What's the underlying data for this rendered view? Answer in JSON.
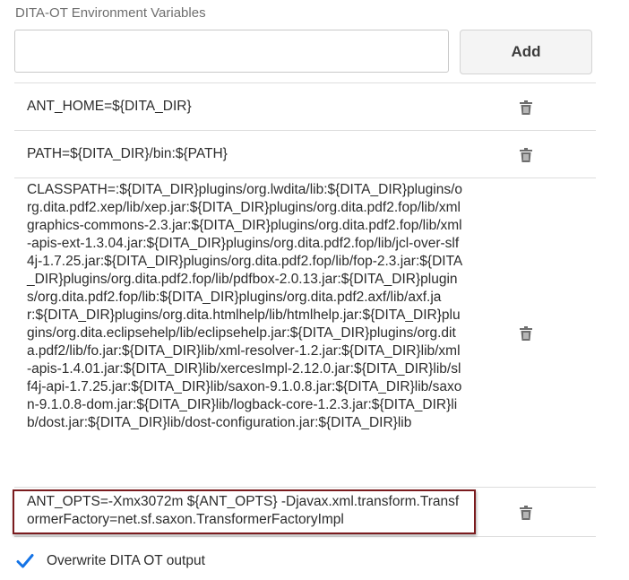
{
  "section": {
    "title": "DITA-OT Environment Variables"
  },
  "input": {
    "value": "",
    "placeholder": ""
  },
  "add_button": {
    "label": "Add"
  },
  "variables": [
    {
      "text": "ANT_HOME=${DITA_DIR}"
    },
    {
      "text": "PATH=${DITA_DIR}/bin:${PATH}"
    },
    {
      "text": "CLASSPATH=:${DITA_DIR}plugins/org.lwdita/lib:${DITA_DIR}plugins/org.dita.pdf2.xep/lib/xep.jar:${DITA_DIR}plugins/org.dita.pdf2.fop/lib/xmlgraphics-commons-2.3.jar:${DITA_DIR}plugins/org.dita.pdf2.fop/lib/xml-apis-ext-1.3.04.jar:${DITA_DIR}plugins/org.dita.pdf2.fop/lib/jcl-over-slf4j-1.7.25.jar:${DITA_DIR}plugins/org.dita.pdf2.fop/lib/fop-2.3.jar:${DITA_DIR}plugins/org.dita.pdf2.fop/lib/pdfbox-2.0.13.jar:${DITA_DIR}plugins/org.dita.pdf2.fop/lib:${DITA_DIR}plugins/org.dita.pdf2.axf/lib/axf.jar:${DITA_DIR}plugins/org.dita.htmlhelp/lib/htmlhelp.jar:${DITA_DIR}plugins/org.dita.eclipsehelp/lib/eclipsehelp.jar:${DITA_DIR}plugins/org.dita.pdf2/lib/fo.jar:${DITA_DIR}lib/xml-resolver-1.2.jar:${DITA_DIR}lib/xml-apis-1.4.01.jar:${DITA_DIR}lib/xercesImpl-2.12.0.jar:${DITA_DIR}lib/slf4j-api-1.7.25.jar:${DITA_DIR}lib/saxon-9.1.0.8.jar:${DITA_DIR}lib/saxon-9.1.0.8-dom.jar:${DITA_DIR}lib/logback-core-1.2.3.jar:${DITA_DIR}lib/dost.jar:${DITA_DIR}lib/dost-configuration.jar:${DITA_DIR}lib"
    },
    {
      "text": "ANT_OPTS=-Xmx3072m ${ANT_OPTS} -Djavax.xml.transform.TransformerFactory=net.sf.saxon.TransformerFactoryImpl"
    }
  ],
  "icons": {
    "delete": "trash-icon",
    "check": "checkmark-icon"
  },
  "colors": {
    "accent": "#1473e6",
    "highlight": "#7a1b1e",
    "icon": "#6e6e6e"
  },
  "overwrite": {
    "label": "Overwrite DITA OT output",
    "checked": true
  }
}
